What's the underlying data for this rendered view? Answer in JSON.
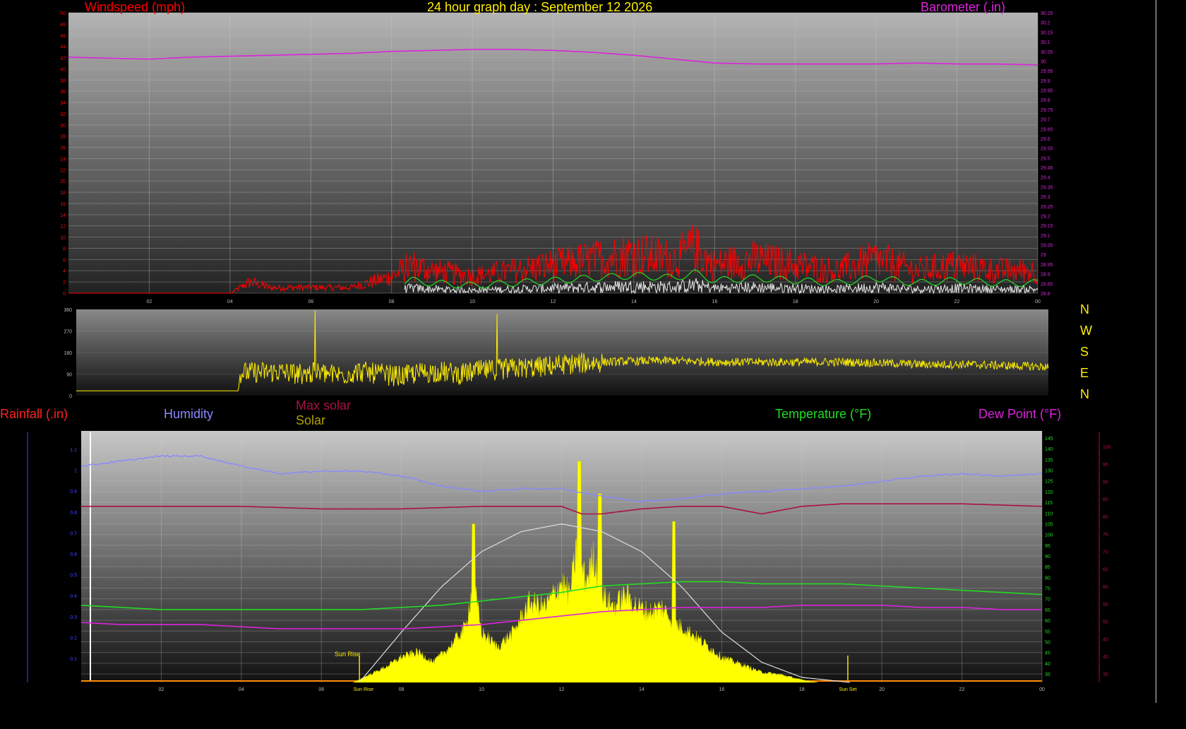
{
  "title": "24 hour graph day : September 12 2026",
  "colors": {
    "wind": "#ff0000",
    "wind_gust": "#ff0000",
    "wind_avg": "#22dd22",
    "wind_low": "#e8e8e8",
    "barometer": "#dd22dd",
    "direction": "#ffee00",
    "humidity": "#8888ff",
    "max_solar": "#aa1144",
    "solar": "#ffff00",
    "temperature": "#22dd22",
    "dew_point": "#dd22dd",
    "rainfall": "#4444ff",
    "sun_curve": "#dddddd"
  },
  "panels": {
    "wind": {
      "left_label": "Windspeed (mph)",
      "right_label": "Barometer (.in)",
      "y_left_ticks": [
        "0",
        "2",
        "4",
        "6",
        "8",
        "10",
        "12",
        "14",
        "16",
        "18",
        "20",
        "22",
        "24",
        "26",
        "28",
        "30",
        "32",
        "34",
        "36",
        "38",
        "40",
        "42",
        "44",
        "46",
        "48",
        "50"
      ],
      "y_right_ticks": [
        "28.8",
        "28.85",
        "28.9",
        "28.95",
        "29",
        "29.05",
        "29.1",
        "29.15",
        "29.2",
        "29.25",
        "29.3",
        "29.35",
        "29.4",
        "29.45",
        "29.5",
        "29.55",
        "29.6",
        "29.65",
        "29.7",
        "29.75",
        "29.8",
        "29.85",
        "29.9",
        "29.95",
        "30",
        "30.05",
        "30.1",
        "30.15",
        "30.2",
        "30.25"
      ],
      "x_ticks": [
        "02",
        "04",
        "06",
        "08",
        "10",
        "12",
        "14",
        "16",
        "18",
        "20",
        "22",
        "00"
      ]
    },
    "direction": {
      "y_ticks": [
        "0",
        "90",
        "180",
        "270",
        "360"
      ],
      "compass": [
        "N",
        "W",
        "S",
        "E",
        "N"
      ]
    },
    "combo": {
      "labels": {
        "rainfall": "Rainfall (.in)",
        "humidity": "Humidity",
        "max_solar": "Max solar",
        "solar": "Solar",
        "temperature": "Temperature (°F)",
        "dew_point": "Dew Point (°F)"
      },
      "temp_ticks": [
        "35",
        "40",
        "45",
        "50",
        "55",
        "60",
        "65",
        "70",
        "75",
        "80",
        "85",
        "90",
        "95",
        "100",
        "105",
        "110",
        "115",
        "120",
        "125",
        "130",
        "135",
        "140",
        "145"
      ],
      "dew_ticks": [
        "35",
        "40",
        "45",
        "50",
        "55",
        "60",
        "65",
        "70",
        "75",
        "80",
        "85",
        "90",
        "95",
        "100"
      ],
      "rain_ticks": [
        "0.1",
        "0.2",
        "0.3",
        "0.4",
        "0.5",
        "0.6",
        "0.7",
        "0.8",
        "0.9",
        "1",
        "1.1"
      ],
      "x_ticks": [
        "02",
        "04",
        "06",
        "Sun Rise",
        "08",
        "10",
        "12",
        "14",
        "16",
        "18",
        "Sun Set",
        "20",
        "22",
        "00"
      ],
      "sunrise_label": "Sun Rise",
      "sunset_label": "Sun Set"
    }
  },
  "chart_data": [
    {
      "type": "line",
      "title": "24 hour graph day : September 12 2026",
      "x_unit": "hour",
      "xlim": [
        0,
        24
      ],
      "series": [
        {
          "name": "Windspeed (mph)",
          "axis": "left",
          "ylim": [
            0,
            50
          ],
          "x": [
            0,
            4,
            4.5,
            5,
            6,
            7,
            7.5,
            8,
            8.5,
            9,
            10,
            11,
            12,
            13,
            14,
            15,
            15.5,
            16,
            17,
            18,
            19,
            20,
            21,
            22,
            23,
            24
          ],
          "y": [
            0,
            0,
            2,
            1,
            1,
            1,
            2,
            3,
            5,
            4,
            3,
            4,
            5,
            6,
            7,
            6,
            8,
            5,
            6,
            5,
            4,
            6,
            4,
            5,
            4,
            4
          ]
        },
        {
          "name": "Barometer (.in)",
          "axis": "right",
          "ylim": [
            28.8,
            30.25
          ],
          "x": [
            0,
            1,
            2,
            3,
            4,
            5,
            6,
            7,
            8,
            9,
            10,
            11,
            12,
            13,
            14,
            15,
            16,
            17,
            18,
            19,
            20,
            21,
            22,
            23,
            24
          ],
          "y": [
            30.02,
            30.015,
            30.01,
            30.02,
            30.025,
            30.03,
            30.035,
            30.04,
            30.05,
            30.055,
            30.06,
            30.06,
            30.055,
            30.045,
            30.03,
            30.01,
            29.99,
            29.985,
            29.985,
            29.985,
            29.985,
            29.99,
            29.985,
            29.985,
            29.98
          ]
        }
      ]
    },
    {
      "type": "line",
      "x_unit": "hour",
      "xlim": [
        0,
        24
      ],
      "ylim": [
        0,
        360
      ],
      "series": [
        {
          "name": "Wind direction",
          "x": [
            0,
            4,
            4.05,
            5,
            5.5,
            6,
            6.5,
            7,
            7.5,
            8,
            8.5,
            9,
            9.5,
            10,
            10.5,
            11,
            11.5,
            12,
            12.5,
            13,
            14,
            15,
            16,
            17,
            18,
            19,
            20,
            21,
            22,
            23,
            24
          ],
          "y": [
            20,
            20,
            95,
            100,
            90,
            95,
            85,
            100,
            90,
            80,
            95,
            100,
            90,
            105,
            110,
            115,
            120,
            130,
            135,
            140,
            145,
            145,
            140,
            140,
            140,
            140,
            135,
            130,
            130,
            125,
            120
          ]
        }
      ]
    },
    {
      "type": "area",
      "x_unit": "hour",
      "xlim": [
        0,
        24
      ],
      "series": [
        {
          "name": "Humidity",
          "axis": "left",
          "x": [
            0,
            1,
            2,
            3,
            4,
            5,
            6,
            7,
            8,
            9,
            10,
            11,
            12,
            13,
            14,
            15,
            16,
            17,
            18,
            19,
            20,
            21,
            22,
            23,
            24
          ],
          "y": [
            86,
            88,
            90,
            90,
            86,
            83,
            84,
            84,
            82,
            78,
            76,
            77,
            77,
            74,
            72,
            73,
            75,
            76,
            77,
            78,
            80,
            82,
            83,
            82,
            83
          ]
        },
        {
          "name": "Max solar",
          "axis": "left",
          "x": [
            0,
            2,
            4,
            6,
            8,
            10,
            11,
            12,
            12.5,
            13,
            14,
            15,
            16,
            17,
            18,
            19,
            20,
            22,
            24
          ],
          "y": [
            70,
            70,
            70,
            69,
            69,
            70,
            70,
            70,
            67,
            67,
            69,
            70,
            70,
            67,
            70,
            71,
            71,
            71,
            70
          ]
        },
        {
          "name": "Temperature (°F)",
          "axis": "right",
          "x": [
            0,
            1,
            2,
            3,
            4,
            5,
            6,
            7,
            8,
            9,
            10,
            11,
            12,
            13,
            14,
            15,
            16,
            17,
            18,
            19,
            20,
            21,
            22,
            23,
            24
          ],
          "y": [
            67,
            66,
            65,
            65,
            65,
            65,
            65,
            65,
            66,
            67,
            69,
            71,
            73,
            76,
            77,
            78,
            78,
            77,
            77,
            77,
            76,
            75,
            74,
            73,
            72
          ]
        },
        {
          "name": "Dew Point (°F)",
          "axis": "right",
          "x": [
            0,
            1,
            2,
            3,
            4,
            5,
            6,
            7,
            8,
            9,
            10,
            11,
            12,
            13,
            14,
            15,
            16,
            17,
            18,
            19,
            20,
            21,
            22,
            23,
            24
          ],
          "y": [
            59,
            58,
            58,
            58,
            57,
            56,
            56,
            56,
            56,
            57,
            58,
            60,
            62,
            64,
            65,
            66,
            66,
            66,
            67,
            67,
            67,
            66,
            66,
            65,
            65
          ]
        },
        {
          "name": "Solar",
          "axis": "left",
          "x": [
            6.8,
            7.2,
            7.6,
            8,
            8.4,
            8.8,
            9.2,
            9.6,
            9.8,
            10,
            10.4,
            10.8,
            11.2,
            11.6,
            12,
            12.2,
            12.4,
            12.6,
            12.8,
            13,
            13.3,
            13.6,
            13.9,
            14.2,
            14.5,
            14.8,
            15.2,
            15.6,
            16,
            16.5,
            17,
            17.5,
            18,
            18.4
          ],
          "y": [
            0,
            3,
            6,
            10,
            12,
            8,
            14,
            22,
            40,
            20,
            14,
            20,
            32,
            30,
            40,
            35,
            55,
            40,
            50,
            35,
            30,
            35,
            30,
            28,
            30,
            24,
            20,
            15,
            10,
            7,
            4,
            3,
            1,
            0
          ]
        },
        {
          "name": "Sun curve",
          "x": [
            6.95,
            8,
            9,
            10,
            11,
            12,
            13,
            14,
            15,
            16,
            17,
            18,
            19.2
          ],
          "y": [
            0,
            20,
            38,
            52,
            60,
            63,
            60,
            52,
            38,
            20,
            8,
            2,
            0
          ]
        }
      ]
    }
  ]
}
